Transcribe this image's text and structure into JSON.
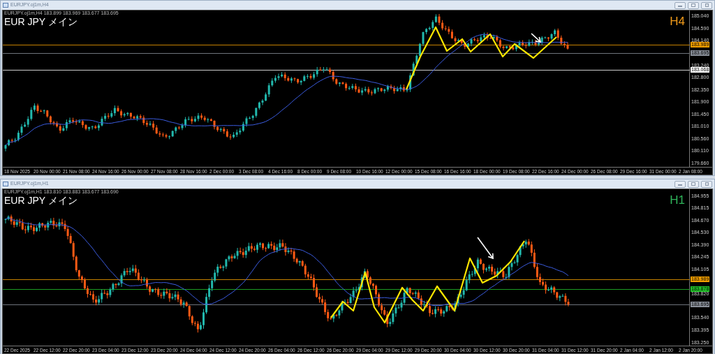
{
  "windows": [
    {
      "title": "EURJPY.oj1m,H4",
      "info": "EURJPY.oj1m,H4  183.899 183.969 183.677 183.695",
      "symbol_label": "EUR JPY  メイン",
      "timeframe": "H4",
      "color": "#f09a1a",
      "price_labels": [
        "185.040",
        "184.590",
        "184.140",
        "183.240",
        "182.800",
        "182.350",
        "181.900",
        "181.450",
        "181.010",
        "180.560",
        "180.110",
        "179.660"
      ],
      "price_markers": [
        {
          "value": "183.989",
          "color": "#f5a000"
        },
        {
          "value": "183.695",
          "color": "#8a909a"
        },
        {
          "value": "183.068",
          "color": "#ffffff"
        }
      ],
      "time_labels": [
        "18 Nov 2025",
        "20 Nov 00:00",
        "21 Nov 08:00",
        "24 Nov 16:00",
        "26 Nov 00:00",
        "27 Nov 08:00",
        "28 Nov 16:00",
        "2 Dec 00:00",
        "3 Dec 08:00",
        "4 Dec 16:00",
        "8 Dec 00:00",
        "9 Dec 08:00",
        "10 Dec 16:00",
        "12 Dec 00:00",
        "15 Dec 08:00",
        "16 Dec 16:00",
        "18 Dec 00:00",
        "19 Dec 08:00",
        "22 Dec 16:00",
        "24 Dec 00:00",
        "26 Dec 08:00",
        "29 Dec 16:00",
        "31 Dec 00:00",
        "2 Jan 08:00"
      ]
    },
    {
      "title": "EURJPY.oj1m,H1",
      "info": "EURJPY.oj1m,H1  183.810 183.883 183.677 183.690",
      "symbol_label": "EUR JPY  メイン",
      "timeframe": "H1",
      "color": "#2fb45a",
      "price_labels": [
        "184.955",
        "184.815",
        "184.670",
        "184.530",
        "184.390",
        "184.245",
        "184.105",
        "183.820",
        "183.540",
        "183.395",
        "183.250"
      ],
      "price_markers": [
        {
          "value": "183.989",
          "color": "#f5a000"
        },
        {
          "value": "183.878",
          "color": "#22c22a"
        },
        {
          "value": "183.695",
          "color": "#8a909a"
        }
      ],
      "time_labels": [
        "22 Dec 2025",
        "22 Dec 12:00",
        "22 Dec 20:00",
        "23 Dec 04:00",
        "23 Dec 12:00",
        "23 Dec 20:00",
        "24 Dec 04:00",
        "24 Dec 12:00",
        "24 Dec 20:00",
        "26 Dec 04:00",
        "26 Dec 12:00",
        "26 Dec 20:00",
        "29 Dec 04:00",
        "29 Dec 12:00",
        "29 Dec 20:00",
        "30 Dec 04:00",
        "30 Dec 12:00",
        "30 Dec 20:00",
        "31 Dec 04:00",
        "31 Dec 12:00",
        "31 Dec 20:00",
        "2 Jan 04:00",
        "2 Jan 12:00",
        "2 Jan 20:00"
      ]
    }
  ]
}
